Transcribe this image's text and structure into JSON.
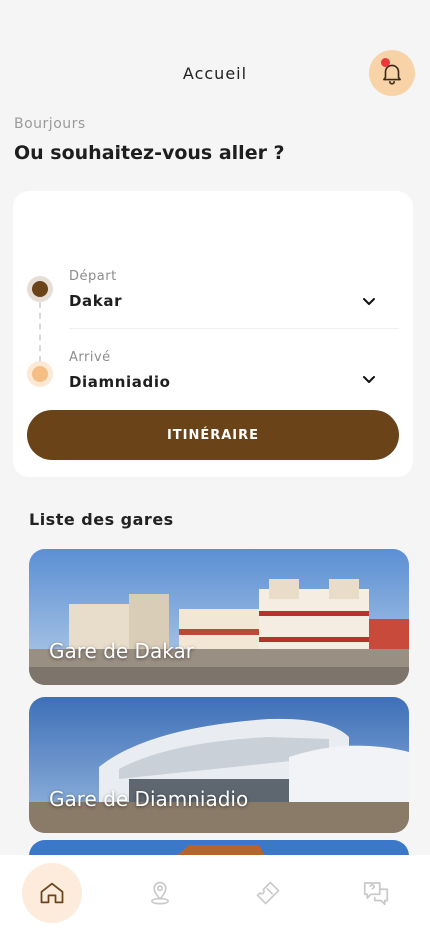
{
  "header": {
    "title": "Accueil",
    "notification_icon": "bell-icon",
    "has_notification": true
  },
  "greeting": "Bourjours",
  "question": "Ou souhaitez-vous aller ?",
  "route": {
    "depart": {
      "label": "Départ",
      "value": "Dakar"
    },
    "arrive": {
      "label": "Arrivé",
      "value": "Diamniadio"
    },
    "button_label": "ITINÉRAIRE"
  },
  "stations": {
    "title": "Liste des gares",
    "items": [
      {
        "name": "Gare de Dakar"
      },
      {
        "name": "Gare de Diamniadio"
      }
    ]
  },
  "tabbar": {
    "items": [
      {
        "icon": "home-icon",
        "active": true
      },
      {
        "icon": "map-pin-icon",
        "active": false
      },
      {
        "icon": "ticket-icon",
        "active": false
      },
      {
        "icon": "help-chat-icon",
        "active": false
      }
    ]
  },
  "colors": {
    "primary": "#6b4318",
    "accent_light": "#f7d3a7",
    "background": "#f5f5f5"
  }
}
